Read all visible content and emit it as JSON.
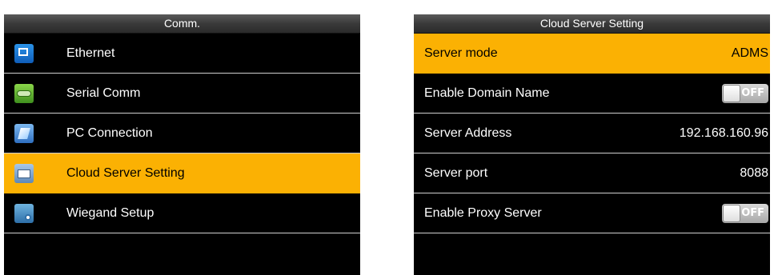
{
  "left_panel": {
    "title": "Comm.",
    "items": [
      {
        "label": "Ethernet",
        "icon": "ethernet-icon"
      },
      {
        "label": "Serial Comm",
        "icon": "serial-port-icon"
      },
      {
        "label": "PC Connection",
        "icon": "pc-connection-icon"
      },
      {
        "label": "Cloud Server Setting",
        "icon": "cloud-server-icon",
        "selected": true
      },
      {
        "label": "Wiegand Setup",
        "icon": "wiegand-icon"
      }
    ]
  },
  "right_panel": {
    "title": "Cloud Server Setting",
    "items": [
      {
        "label": "Server mode",
        "value": "ADMS",
        "selected": true
      },
      {
        "label": "Enable Domain Name",
        "toggle": "OFF"
      },
      {
        "label": "Server Address",
        "value": "192.168.160.96"
      },
      {
        "label": "Server port",
        "value": "8088"
      },
      {
        "label": "Enable Proxy Server",
        "toggle": "OFF"
      }
    ]
  },
  "colors": {
    "highlight": "#fbb103",
    "background": "#000000",
    "text": "#ffffff"
  }
}
